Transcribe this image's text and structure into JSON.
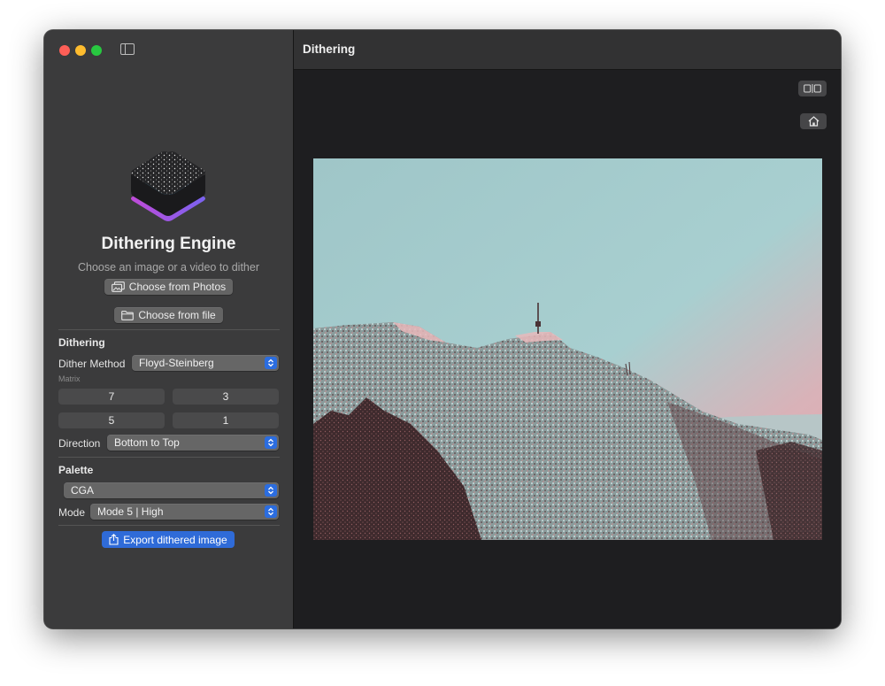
{
  "window": {
    "title": "Dithering"
  },
  "sidebar": {
    "app_title": "Dithering Engine",
    "app_subtitle": "Choose an image or a video to dither",
    "choose_photos_label": "Choose from Photos",
    "choose_file_label": "Choose from file",
    "dithering_section": "Dithering",
    "dither_method_label": "Dither Method",
    "dither_method_value": "Floyd-Steinberg",
    "matrix_label": "Matrix",
    "matrix_values": [
      "7",
      "3",
      "5",
      "1"
    ],
    "direction_label": "Direction",
    "direction_value": "Bottom to Top",
    "palette_section": "Palette",
    "palette_value": "CGA",
    "mode_label": "Mode",
    "mode_value": "Mode 5 | High",
    "export_label": "Export dithered image"
  },
  "colors": {
    "accent": "#2f6bd8",
    "sidebar_bg": "#3b3b3c",
    "content_bg": "#1e1e20"
  },
  "icons": {
    "photos": "photo-stack-icon",
    "file": "folder-icon",
    "export": "share-icon",
    "compare": "split-compare-icon",
    "home": "house-icon"
  }
}
